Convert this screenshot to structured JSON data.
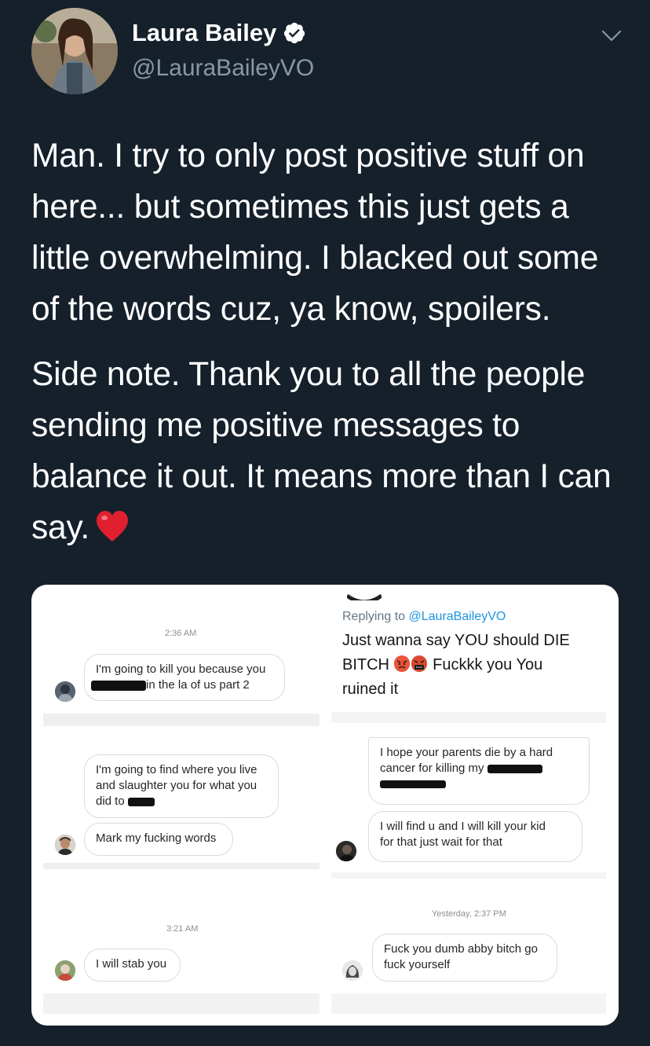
{
  "author": {
    "name": "Laura Bailey",
    "handle": "@LauraBaileyVO"
  },
  "tweet": {
    "paragraph_1": "Man. I try to only post positive stuff on here... but sometimes this just gets a little overwhelming. I blacked out some of the words cuz, ya know, spoilers.",
    "paragraph_2": "Side note. Thank you to all the people sending me positive messages to balance it out. It means more than I can say.",
    "heart_emoji": "❤️"
  },
  "media": {
    "left": {
      "timestamp_1": "2:36 AM",
      "msg_1_line_1": "I'm going to kill you because you",
      "msg_1_line_2": "in the la of us part 2",
      "msg_2_line_1": "I'm going to find where you live",
      "msg_2_line_2": "and slaughter you for what you",
      "msg_2_line_3": "did to",
      "msg_3": "Mark my fucking words",
      "timestamp_2": "3:21 AM",
      "msg_4": "I will stab you"
    },
    "right": {
      "replying_label": "Replying to ",
      "replying_handle": "@LauraBaileyVO",
      "reply_line_1": "Just wanna say YOU should DIE",
      "reply_line_2a": "BITCH",
      "reply_line_2b": "Fuckkk you You",
      "reply_line_3": "ruined it",
      "msg_1_line_1": "I hope your parents die by a hard",
      "msg_1_line_2": "cancer for killing my",
      "msg_2_line_1": "I will find u and I will kill your kid",
      "msg_2_line_2": "for that just wait for that",
      "timestamp": "Yesterday, 2:37 PM",
      "msg_3_line_1": "Fuck you dumb abby bitch go",
      "msg_3_line_2": "fuck yourself"
    }
  },
  "colors": {
    "background": "#15202b",
    "secondary_text": "#8899a6",
    "verified_badge": "#ffffff",
    "link": "#1b95e0"
  },
  "icons": [
    "verified-badge-icon",
    "chevron-down-icon",
    "angry-face-emoji",
    "cursing-face-emoji",
    "red-heart-emoji"
  ]
}
